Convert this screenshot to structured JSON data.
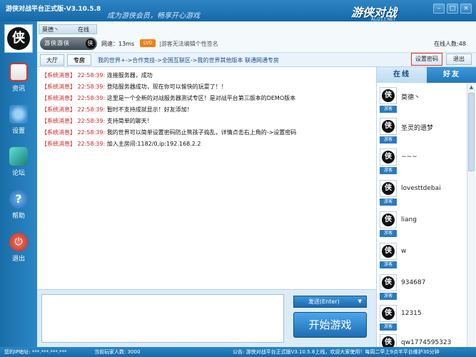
{
  "window": {
    "title": "游侠对战平台正式版-V3.10.5.8",
    "slogan": "成为游侠会员，畅享开心游戏",
    "brand": "游侠对战",
    "brand_url": "ALI213.NET",
    "min": "–",
    "restore": "□",
    "close": "×"
  },
  "sidebar": {
    "avatar_glyph": "侠",
    "items": [
      {
        "label": "资讯",
        "icon": "news-icon",
        "color": "#d13a2a"
      },
      {
        "label": "设置",
        "icon": "gear-icon",
        "color": "#3c8fd0"
      },
      {
        "label": "论坛",
        "icon": "forum-cube-icon",
        "color": "#2bb0a5"
      },
      {
        "label": "帮助",
        "icon": "help-icon",
        "color": "#2f7fd3"
      },
      {
        "label": "退出",
        "icon": "power-icon",
        "color": "#d63a2e"
      }
    ]
  },
  "user": {
    "name": "莫德丶",
    "status": "在线",
    "rank_label": "游侠游侠",
    "rank_glyph": "侠",
    "net_speed": "网速：13ms",
    "level": "LV0",
    "signature": "|游客无法编辑个性签名",
    "online_count": "在线人数:48"
  },
  "room_tabs": [
    {
      "label": "大厅"
    },
    {
      "label": "专房"
    }
  ],
  "breadcrumb": "我的世界+->合作竞技->全国互联区->我的世界其他版本 联通网通专房",
  "buttons": {
    "set_password": "设置密码",
    "exit": "退出",
    "send": "发送(Enter)",
    "send_arrow": "▼",
    "start_game": "开始游戏"
  },
  "messages": [
    {
      "tag": "【系统消息】",
      "time": "22:58:39:",
      "text": "连接服务器，成功"
    },
    {
      "tag": "【系统消息】",
      "time": "22:58:39:",
      "text": "登陆服务器成功，现在你可以愉快的玩耍了！！"
    },
    {
      "tag": "【系统消息】",
      "time": "22:58:39:",
      "text": "这里是一个全新的对战服务器测试专区！是对战平台第三版本的DEMO版本"
    },
    {
      "tag": "【系统消息】",
      "time": "22:58:39:",
      "text": "暂时不支持成就显示！好友添加！"
    },
    {
      "tag": "【系统消息】",
      "time": "22:58:39:",
      "text": "支持简单的聊天！"
    },
    {
      "tag": "【系统消息】",
      "time": "22:58:39:",
      "text": "我的世界可以简单设置密码防止熊孩子捣乱，详情点击右上角的->设置密码"
    },
    {
      "tag": "【系统消息】",
      "time": "22:58:39:",
      "text": "加入主房间:1182/0,ip:192.168.2.2"
    }
  ],
  "right_tabs": [
    {
      "label": "在线"
    },
    {
      "label": "好友"
    }
  ],
  "online_users": [
    {
      "name": "莫德丶",
      "badge": "游客",
      "glyph": "侠"
    },
    {
      "name": "圣灵的遗梦",
      "badge": "游客",
      "glyph": "侠"
    },
    {
      "name": "~~~",
      "badge": "游客",
      "glyph": "侠"
    },
    {
      "name": "lovesttdebai",
      "badge": "游客",
      "glyph": "侠"
    },
    {
      "name": "liang",
      "badge": "游客",
      "glyph": "侠"
    },
    {
      "name": "w",
      "badge": "游客",
      "glyph": "侠"
    },
    {
      "name": "934687",
      "badge": "游客",
      "glyph": "侠"
    },
    {
      "name": "12315",
      "badge": "游客",
      "glyph": "侠"
    },
    {
      "name": "qw1774595323",
      "badge": "游客",
      "glyph": "侠"
    }
  ],
  "scroll_up": "▲",
  "statusbar": {
    "ip": "您的IP地址: ***.***.***.***",
    "players": "当前玩家人数: 3000",
    "notice": "公告: 游侠对战平台正式版V3.10.5.8上线，欢迎大家使用！每周二早上9点半平台维护30分钟"
  }
}
